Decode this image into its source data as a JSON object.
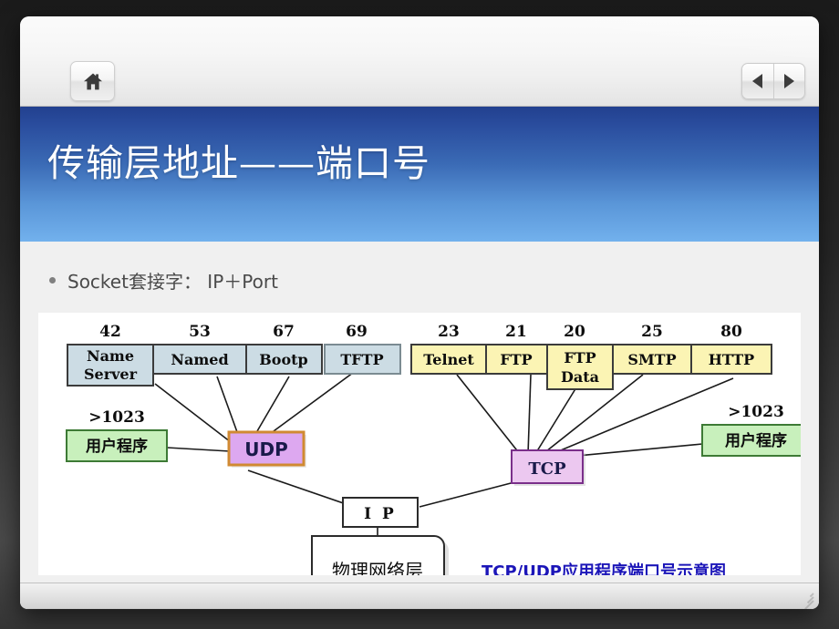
{
  "toolbar": {
    "home_icon": "home-icon",
    "prev_icon": "triangle-left-icon",
    "next_icon": "triangle-right-icon"
  },
  "slide": {
    "title": "传输层地址——端口号",
    "bullet": "Socket套接字： IP＋Port"
  },
  "colors": {
    "band_top": "#22408f",
    "band_bottom": "#72b1ed",
    "udp_fill": "#dda8f0",
    "udp_border": "#d08a32",
    "tcp_fill": "#ecc8f0",
    "tcp_border": "#7a2f8a",
    "blue_box_fill": "#ccdce4",
    "yellow_box_fill": "#fbf4b4",
    "green_box_fill": "#c8f0bc",
    "green_box_border": "#3d7a35",
    "caption_color": "#1b15b8"
  },
  "diagram": {
    "caption": "TCP/UDP应用程序端口号示意图",
    "udp_label": "UDP",
    "tcp_label": "TCP",
    "ip_label": "I P",
    "physical_layer_label": "物理网络层",
    "udp_user_port": ">1023",
    "tcp_user_port": ">1023",
    "udp_user_label": "用户程序",
    "tcp_user_label": "用户程序",
    "udp_services": [
      {
        "port": "42",
        "name": "Name Server",
        "line1": "Name",
        "line2": "Server"
      },
      {
        "port": "53",
        "name": "Named",
        "line1": "Named",
        "line2": ""
      },
      {
        "port": "67",
        "name": "Bootp",
        "line1": "Bootp",
        "line2": ""
      },
      {
        "port": "69",
        "name": "TFTP",
        "line1": "TFTP",
        "line2": ""
      }
    ],
    "tcp_services": [
      {
        "port": "23",
        "name": "Telnet",
        "line1": "Telnet",
        "line2": ""
      },
      {
        "port": "21",
        "name": "FTP",
        "line1": "FTP",
        "line2": ""
      },
      {
        "port": "20",
        "name": "FTP Data",
        "line1": "FTP",
        "line2": "Data"
      },
      {
        "port": "25",
        "name": "SMTP",
        "line1": "SMTP",
        "line2": ""
      },
      {
        "port": "80",
        "name": "HTTP",
        "line1": "HTTP",
        "line2": ""
      }
    ]
  }
}
